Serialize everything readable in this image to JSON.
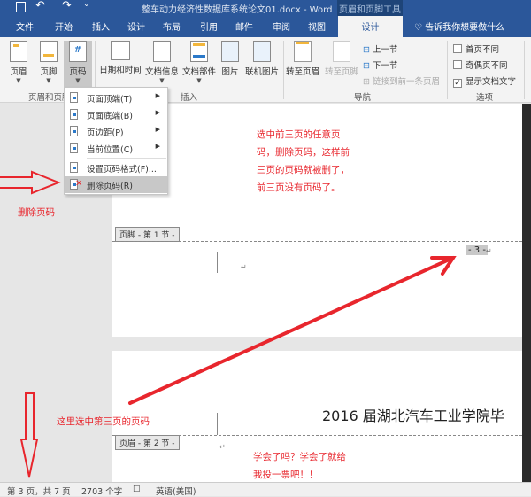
{
  "titlebar": {
    "save_icon": "save-icon",
    "undo_icon": "undo-icon",
    "redo_icon": "redo-icon",
    "customize_icon": "customize-qat-icon",
    "doc_title": "整车动力经济性数据库系统论文01.docx - Word",
    "context_tab_group": "页眉和页脚工具"
  },
  "tabs": [
    {
      "label": "文件"
    },
    {
      "label": "开始"
    },
    {
      "label": "插入"
    },
    {
      "label": "设计"
    },
    {
      "label": "布局"
    },
    {
      "label": "引用"
    },
    {
      "label": "邮件"
    },
    {
      "label": "审阅"
    },
    {
      "label": "视图"
    },
    {
      "label": "设计",
      "active": true
    }
  ],
  "tell_me": "告诉我你想要做什么",
  "ribbon": {
    "header_footer_group": {
      "label": "页眉和页脚",
      "buttons": [
        {
          "label": "页眉"
        },
        {
          "label": "页脚"
        },
        {
          "label": "页码",
          "selected": true
        }
      ]
    },
    "insert_group": {
      "label": "插入",
      "buttons": [
        {
          "label": "日期和时间"
        },
        {
          "label": "文档信息"
        },
        {
          "label": "文档部件"
        },
        {
          "label": "图片"
        },
        {
          "label": "联机图片"
        }
      ]
    },
    "nav_group": {
      "label": "导航",
      "goto_header": "转至页眉",
      "goto_footer": "转至页脚",
      "prev_section": "上一节",
      "next_section": "下一节",
      "link_previous": "链接到前一条页眉"
    },
    "options_group": {
      "label": "选项",
      "options": [
        {
          "label": "首页不同",
          "checked": false
        },
        {
          "label": "奇偶页不同",
          "checked": false
        },
        {
          "label": "显示文档文字",
          "checked": true
        }
      ]
    }
  },
  "page_number_menu": {
    "items": [
      {
        "label": "页面顶端(T)",
        "submenu": true
      },
      {
        "label": "页面底端(B)",
        "submenu": true
      },
      {
        "label": "页边距(P)",
        "submenu": true
      },
      {
        "label": "当前位置(C)",
        "submenu": true
      },
      {
        "label": "设置页码格式(F)...",
        "submenu": false
      },
      {
        "label": "删除页码(R)",
        "submenu": false,
        "highlighted": true
      }
    ]
  },
  "annotations": {
    "delete_label": "删除页码",
    "instruction": "选中前三页的任意页码，删除页码，这样前三页的页码就被删了，前三页没有页码了。",
    "select_here": "这里选中第三页的页码",
    "closing": "学会了吗？学会了就给我投一票吧！！"
  },
  "document": {
    "footer_tag": "页脚 - 第 1 节 -",
    "page_number": "- 3 -",
    "header_tag": "页眉 - 第 2 节 -",
    "header_text": "2016 届湖北汽车工业学院毕",
    "para_mark": "↵"
  },
  "statusbar": {
    "page_info": "第 3 页，共 7 页",
    "word_count": "2703 个字",
    "proofing_icon": "proofing-icon",
    "language": "英语(美国)"
  },
  "colors": {
    "word_blue": "#2b579a",
    "annotation_red": "#e8262d"
  }
}
